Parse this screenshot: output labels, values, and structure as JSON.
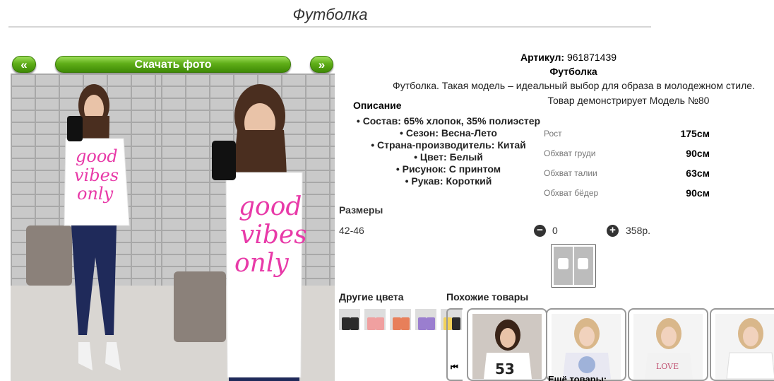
{
  "page": {
    "title": "Футболка"
  },
  "gallery": {
    "prev_label": "«",
    "next_label": "»",
    "download_label": "Скачать фото"
  },
  "product": {
    "sku_label": "Артикул:",
    "sku_value": "961871439",
    "name": "Футболка",
    "description": "Футболка. Такая модель – идеальный выбор для образа в молодежном стиле.",
    "model_note": "Товар демонстрирует Модель №80"
  },
  "description_section": {
    "heading": "Описание",
    "attributes": [
      "Состав: 65% хлопок, 35% полиэстер",
      "Сезон: Весна-Лето",
      "Страна-производитель: Китай",
      "Цвет: Белый",
      "Рисунок: С принтом",
      "Рукав: Короткий"
    ]
  },
  "measurements": [
    {
      "label": "Рост",
      "value": "175см"
    },
    {
      "label": "Обхват груди",
      "value": "90см"
    },
    {
      "label": "Обхват талии",
      "value": "63см"
    },
    {
      "label": "Обхват бёдер",
      "value": "90см"
    }
  ],
  "sizes": {
    "heading": "Размеры",
    "row": {
      "size": "42-46",
      "minus_icon": "minus-circle-icon",
      "plus_icon": "plus-circle-icon",
      "quantity": "0",
      "price": "358р."
    }
  },
  "other_colors": {
    "heading": "Другие цвета",
    "swatch_colors": [
      "#2b2b2b",
      "#f0a0a0",
      "#e87f5a",
      "#9a7ecf",
      "#f2d25a"
    ]
  },
  "similar": {
    "heading": "Похожие товары",
    "prev_icon": "skip-back-icon",
    "more_label": "Ещё товары:"
  },
  "colors": {
    "button_green": "#5fae18",
    "print_pink": "#e83aa8",
    "jeans_blue": "#1f2a5a"
  }
}
